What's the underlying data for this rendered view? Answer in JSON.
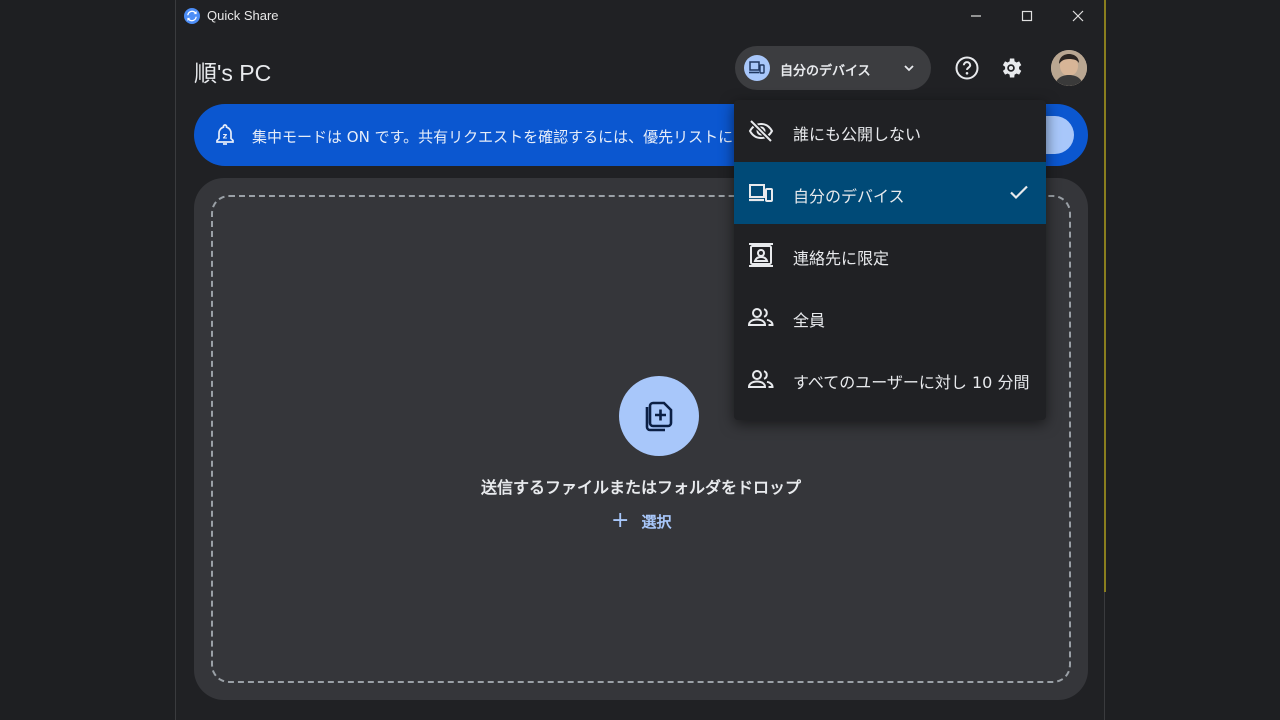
{
  "window": {
    "title": "Quick Share",
    "controls": {
      "minimize": "minimize",
      "maximize": "maximize",
      "close": "close"
    }
  },
  "header": {
    "device_name": "順's PC",
    "visibility_selector": {
      "label": "自分のデバイス",
      "icon": "devices-icon"
    },
    "help_icon": "help-icon",
    "settings_icon": "gear-icon"
  },
  "banner": {
    "text": "集中モードは ON です。共有リクエストを確認するには、優先リストに Quick Share",
    "icon": "focus-bell-icon"
  },
  "drop_area": {
    "label": "送信するファイルまたはフォルダをドロップ",
    "select_label": "選択",
    "icon": "add-file-icon"
  },
  "visibility_menu": {
    "items": [
      {
        "label": "誰にも公開しない",
        "icon": "eye-off-icon",
        "selected": false
      },
      {
        "label": "自分のデバイス",
        "icon": "devices-icon",
        "selected": true
      },
      {
        "label": "連絡先に限定",
        "icon": "contact-icon",
        "selected": false
      },
      {
        "label": "全員",
        "icon": "people-icon",
        "selected": false
      },
      {
        "label": "すべてのユーザーに対し 10 分間",
        "icon": "people-icon",
        "selected": false
      }
    ]
  },
  "colors": {
    "accent": "#a8c7fa",
    "banner": "#0b57d0",
    "selected_item": "#004a77",
    "background": "#202124"
  }
}
